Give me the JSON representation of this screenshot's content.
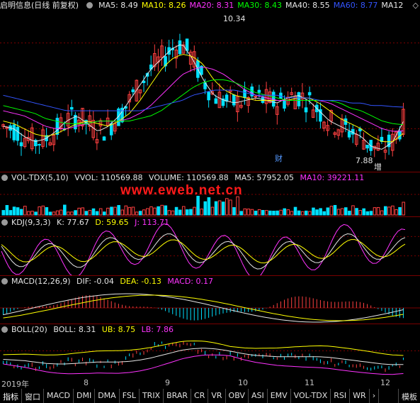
{
  "colors": {
    "up": "#ff4040",
    "down": "#00e0ff",
    "ma5": "#e6e6e6",
    "ma10": "#ffff00",
    "ma20": "#ff33ff",
    "ma30": "#00ff00",
    "ma40": "#e6e6e6",
    "ma60": "#3355ff",
    "label_yellow": "#ffff00",
    "label_magenta": "#ff33ff",
    "grid": "#7a0000"
  },
  "main": {
    "title": "启明信息(日线 前复权)",
    "indicators": [
      {
        "label": "MA5: 8.49",
        "color": "#e6e6e6"
      },
      {
        "label": "MA10: 8.26",
        "color": "#ffff00"
      },
      {
        "label": "MA20: 8.31",
        "color": "#ff33ff"
      },
      {
        "label": "MA30: 8.43",
        "color": "#00ff00"
      },
      {
        "label": "MA40: 8.55",
        "color": "#e6e6e6"
      },
      {
        "label": "MA60: 8.77",
        "color": "#3355ff"
      },
      {
        "label": "MA12",
        "color": "#e6e6e6"
      }
    ],
    "high_label": "10.34",
    "low_label": "7.88",
    "marker_cai": "财",
    "marker_zeng": "增"
  },
  "vol": {
    "title": "VOL-TDX(5,10)",
    "vvol": "VVOL: 110569.88",
    "volume": "VOLUME: 110569.88",
    "ma5": "MA5: 57952.05",
    "ma10": "MA10: 39221.11"
  },
  "kdj": {
    "title": "KDJ(9,3,3)",
    "k": "K: 77.67",
    "d": "D: 59.65",
    "j": "J: 113.71"
  },
  "macd": {
    "title": "MACD(12,26,9)",
    "dif": "DIF: -0.04",
    "dea": "DEA: -0.13",
    "macd": "MACD: 0.17"
  },
  "boll": {
    "title": "BOLL(20)",
    "boll": "BOLL: 8.31",
    "ub": "UB: 8.75",
    "lb": "LB: 7.86"
  },
  "watermark": "www.eweb.net.cn",
  "xaxis": {
    "year_label": "2019年",
    "months": [
      "8",
      "9",
      "10",
      "11",
      "12"
    ]
  },
  "tabs": [
    "指标",
    "窗口",
    "MACD",
    "DMI",
    "DMA",
    "FSL",
    "TRIX",
    "BRAR",
    "CR",
    "VR",
    "OBV",
    "ASI",
    "EMV",
    "VOL-TDX",
    "RSI",
    "WR",
    "›",
    "模板"
  ],
  "chart_data": [
    {
      "type": "line",
      "title": "启明信息(日线 前复权)",
      "series": [
        {
          "name": "MA5",
          "values": [
            8.4,
            8.35,
            8.2,
            8.1,
            8.15,
            8.3,
            8.5,
            8.6,
            8.45,
            8.3,
            8.4,
            8.6,
            8.9,
            9.2,
            9.5,
            9.7,
            9.9,
            10.0,
            9.7,
            9.3,
            9.0,
            8.9,
            8.85,
            8.9,
            8.95,
            8.9,
            8.85,
            8.95,
            9.0,
            8.9,
            8.7,
            8.5,
            8.4,
            8.3,
            8.2,
            8.0,
            7.95,
            8.1,
            8.49
          ]
        },
        {
          "name": "MA10",
          "values": [
            8.5,
            8.45,
            8.35,
            8.25,
            8.2,
            8.25,
            8.35,
            8.45,
            8.5,
            8.45,
            8.4,
            8.5,
            8.65,
            8.9,
            9.2,
            9.5,
            9.7,
            9.8,
            9.75,
            9.6,
            9.3,
            9.1,
            9.0,
            8.95,
            8.9,
            8.9,
            8.9,
            8.9,
            8.95,
            8.95,
            8.85,
            8.7,
            8.55,
            8.45,
            8.35,
            8.2,
            8.1,
            8.1,
            8.26
          ]
        },
        {
          "name": "MA20",
          "values": [
            8.7,
            8.65,
            8.6,
            8.5,
            8.4,
            8.35,
            8.35,
            8.4,
            8.45,
            8.5,
            8.5,
            8.5,
            8.55,
            8.65,
            8.8,
            9.0,
            9.2,
            9.4,
            9.5,
            9.55,
            9.5,
            9.4,
            9.25,
            9.1,
            9.0,
            8.95,
            8.9,
            8.9,
            8.9,
            8.9,
            8.9,
            8.85,
            8.75,
            8.65,
            8.55,
            8.45,
            8.35,
            8.3,
            8.31
          ]
        },
        {
          "name": "MA30",
          "values": [
            8.8,
            8.75,
            8.7,
            8.65,
            8.55,
            8.5,
            8.45,
            8.45,
            8.45,
            8.5,
            8.5,
            8.5,
            8.5,
            8.55,
            8.6,
            8.7,
            8.85,
            9.0,
            9.15,
            9.25,
            9.3,
            9.3,
            9.25,
            9.15,
            9.05,
            9.0,
            8.95,
            8.9,
            8.9,
            8.9,
            8.9,
            8.9,
            8.85,
            8.75,
            8.7,
            8.6,
            8.5,
            8.45,
            8.43
          ]
        },
        {
          "name": "MA60",
          "values": [
            9.0,
            8.95,
            8.9,
            8.85,
            8.8,
            8.75,
            8.7,
            8.7,
            8.7,
            8.7,
            8.7,
            8.7,
            8.7,
            8.7,
            8.75,
            8.8,
            8.85,
            8.9,
            9.0,
            9.05,
            9.1,
            9.1,
            9.1,
            9.05,
            9.0,
            9.0,
            9.0,
            8.95,
            8.95,
            8.95,
            8.9,
            8.9,
            8.9,
            8.85,
            8.85,
            8.8,
            8.8,
            8.78,
            8.77
          ]
        }
      ]
    }
  ]
}
